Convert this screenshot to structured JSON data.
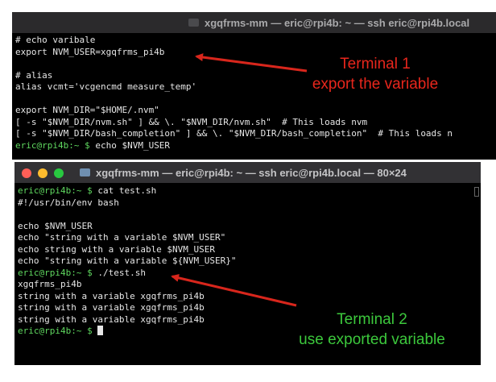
{
  "terminal1": {
    "title": "xgqfrms-mm — eric@rpi4b: ~ — ssh eric@rpi4b.local",
    "lines": [
      {
        "text": "# echo varibale"
      },
      {
        "text": "export NVM_USER=xgqfrms_pi4b"
      },
      {
        "text": ""
      },
      {
        "text": "# alias"
      },
      {
        "text": "alias vcmt='vcgencmd measure_temp'"
      },
      {
        "text": ""
      },
      {
        "text": "export NVM_DIR=\"$HOME/.nvm\""
      },
      {
        "text": "[ -s \"$NVM_DIR/nvm.sh\" ] && \\. \"$NVM_DIR/nvm.sh\"  # This loads nvm"
      },
      {
        "text": "[ -s \"$NVM_DIR/bash_completion\" ] && \\. \"$NVM_DIR/bash_completion\"  # This loads n"
      },
      {
        "prompt": "eric@rpi4b:~ $",
        "text": " echo $NVM_USER"
      }
    ]
  },
  "terminal2": {
    "title": "xgqfrms-mm — eric@rpi4b: ~ — ssh eric@rpi4b.local — 80×24",
    "lines": [
      {
        "prompt": "eric@rpi4b:~ $",
        "text": " cat test.sh"
      },
      {
        "text": "#!/usr/bin/env bash"
      },
      {
        "text": ""
      },
      {
        "text": "echo $NVM_USER"
      },
      {
        "text": "echo \"string with a variable $NVM_USER\""
      },
      {
        "text": "echo string with a variable $NVM_USER"
      },
      {
        "text": "echo \"string with a variable ${NVM_USER}\""
      },
      {
        "prompt": "eric@rpi4b:~ $",
        "text": " ./test.sh"
      },
      {
        "text": "xgqfrms_pi4b"
      },
      {
        "text": "string with a variable xgqfrms_pi4b"
      },
      {
        "text": "string with a variable xgqfrms_pi4b"
      },
      {
        "text": "string with a variable xgqfrms_pi4b"
      },
      {
        "prompt": "eric@rpi4b:~ $",
        "text": " ",
        "cursor": true
      }
    ]
  },
  "annotations": {
    "terminal1": {
      "line1": "Terminal 1",
      "line2": "export the variable",
      "color": "#e8261c"
    },
    "terminal2": {
      "line1": "Terminal 2",
      "line2": "use exported variable",
      "color": "#3cc83c"
    }
  },
  "colors": {
    "terminal_bg": "#000000",
    "prompt": "#5fd75f",
    "arrow": "#d8261c",
    "close": "#ff5f57",
    "minimize": "#febc2e",
    "zoom": "#28c840"
  }
}
